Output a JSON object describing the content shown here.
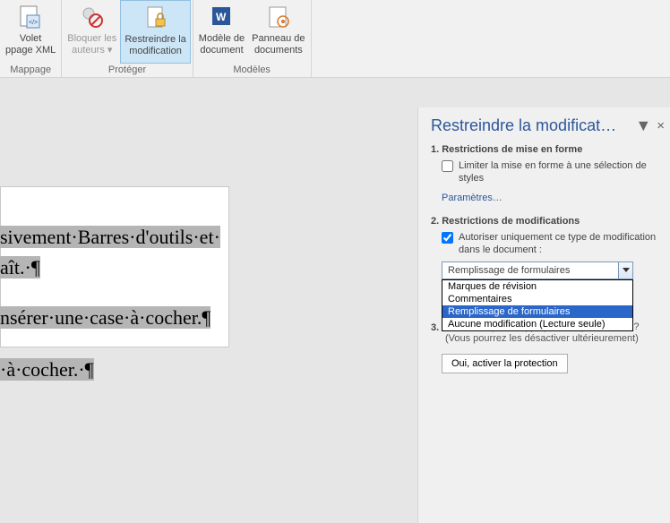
{
  "ribbon": {
    "btn_volet_xml_l1": "Volet",
    "btn_volet_xml_l2": "ppage XML",
    "group_mapping": "Mappage",
    "btn_block_l1": "Bloquer les",
    "btn_block_l2": "auteurs ▾",
    "btn_restrict_l1": "Restreindre la",
    "btn_restrict_l2": "modification",
    "group_protect": "Protéger",
    "btn_model_l1": "Modèle de",
    "btn_model_l2": "document",
    "btn_panel_l1": "Panneau de",
    "btn_panel_l2": "documents",
    "group_models": "Modèles"
  },
  "doc": {
    "l1": "sivement·Barres·d'outils·et·",
    "l2a": "aît.·¶",
    "l3": "nsérer·une·case·à·cocher.¶",
    "l4a": "·à·cocher.·¶"
  },
  "pane": {
    "title": "Restreindre la modificat…",
    "s1_title": "1. Restrictions de mise en forme",
    "s1_check": "Limiter la mise en forme à une sélection de styles",
    "s1_link": "Paramètres…",
    "s2_title": "2. Restrictions de modifications",
    "s2_check": "Autoriser uniquement ce type de modification dans le document :",
    "combo_value": "Remplissage de formulaires",
    "options": [
      "Marques de révision",
      "Commentaires",
      "Remplissage de formulaires",
      "Aucune modification (Lecture seule)"
    ],
    "s3_num": "3.",
    "s3_text": "Êtes-vous prêt à appliquer ces paramètres ? (Vous pourrez les désactiver ultérieurement)",
    "btn_protect": "Oui, activer la protection"
  }
}
